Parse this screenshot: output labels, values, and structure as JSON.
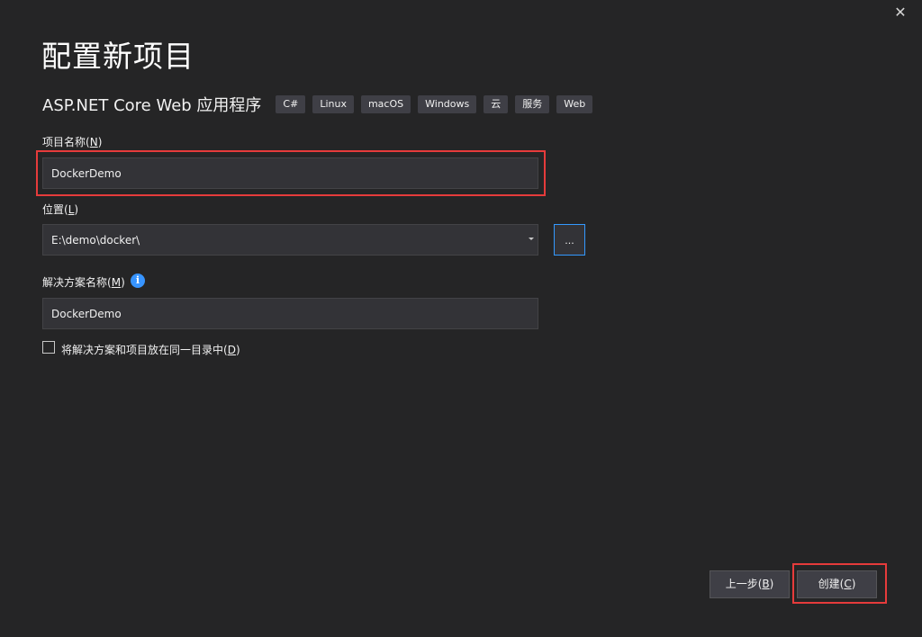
{
  "dialog": {
    "close_glyph": "✕",
    "title": "配置新项目",
    "template": {
      "name": "ASP.NET Core Web 应用程序",
      "tags": [
        "C#",
        "Linux",
        "macOS",
        "Windows",
        "云",
        "服务",
        "Web"
      ]
    },
    "project_name": {
      "label": "项目名称",
      "mnemonic": "N",
      "value": "DockerDemo"
    },
    "location": {
      "label": "位置",
      "mnemonic": "L",
      "value": "E:\\demo\\docker\\",
      "browse_label": "..."
    },
    "solution_name": {
      "label": "解决方案名称",
      "mnemonic": "M",
      "value": "DockerDemo",
      "info_glyph": "i"
    },
    "same_directory": {
      "label": "将解决方案和项目放在同一目录中",
      "mnemonic": "D",
      "checked": false
    },
    "buttons": {
      "back_label": "上一步",
      "back_mnemonic": "B",
      "create_label": "创建",
      "create_mnemonic": "C"
    }
  },
  "colors": {
    "background": "#252526",
    "input_background": "#333337",
    "tag_background": "#3f3f46",
    "highlight_red": "#e63b3b",
    "focus_blue": "#3399ff",
    "info_blue": "#3794ff"
  }
}
